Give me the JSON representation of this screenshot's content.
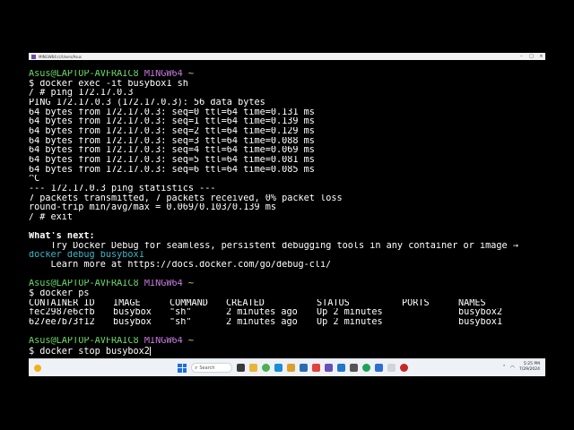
{
  "window": {
    "title": "MINGW64:/c/Users/Asus"
  },
  "terminal": {
    "prompt1": {
      "user": "Asus@LAPTOP-AVFRAIC8",
      "shell": "MINGW64",
      "path": "~"
    },
    "cmd1": "$ docker exec -it busybox1 sh",
    "cmd2": "/ # ping 172.17.0.3",
    "ping_header": "PING 172.17.0.3 (172.17.0.3): 56 data bytes",
    "ping_lines": [
      "64 bytes from 172.17.0.3: seq=0 ttl=64 time=0.131 ms",
      "64 bytes from 172.17.0.3: seq=1 ttl=64 time=0.139 ms",
      "64 bytes from 172.17.0.3: seq=2 ttl=64 time=0.129 ms",
      "64 bytes from 172.17.0.3: seq=3 ttl=64 time=0.088 ms",
      "64 bytes from 172.17.0.3: seq=4 ttl=64 time=0.069 ms",
      "64 bytes from 172.17.0.3: seq=5 ttl=64 time=0.081 ms",
      "64 bytes from 172.17.0.3: seq=6 ttl=64 time=0.085 ms"
    ],
    "interrupt": "^C",
    "stats_header": "--- 172.17.0.3 ping statistics ---",
    "stats_packets": "7 packets transmitted, 7 packets received, 0% packet loss",
    "stats_rtt": "round-trip min/avg/max = 0.069/0.103/0.139 ms",
    "exit_cmd": "/ # exit",
    "whats_next": "What's next:",
    "hint_line": "    Try Docker Debug for seamless, persistent debugging tools in any container or image →",
    "hint_cmd": "docker debug busybox1",
    "learn_more": "    Learn more at https://docs.docker.com/go/debug-cli/",
    "prompt2": {
      "user": "Asus@LAPTOP-AVFRAIC8",
      "shell": "MINGW64",
      "path": "~"
    },
    "cmd_ps": "$ docker ps",
    "ps_headers": [
      "CONTAINER ID",
      "IMAGE",
      "COMMAND",
      "CREATED",
      "STATUS",
      "PORTS",
      "NAMES"
    ],
    "ps_rows": [
      [
        "fec2987e6cfb",
        "busybox",
        "\"sh\"",
        "2 minutes ago",
        "Up 2 minutes",
        "",
        "busybox2"
      ],
      [
        "627ee7b73f12",
        "busybox",
        "\"sh\"",
        "2 minutes ago",
        "Up 2 minutes",
        "",
        "busybox1"
      ]
    ],
    "prompt3": {
      "user": "Asus@LAPTOP-AVFRAIC8",
      "shell": "MINGW64",
      "path": "~"
    },
    "current_input": "$ docker stop busybox2"
  },
  "taskbar": {
    "search_placeholder": "Search",
    "clock_time": "5:25 PM",
    "clock_date": "7/29/2024"
  },
  "colors": {
    "prompt_user": "#6ad86a",
    "prompt_shell": "#c77be0",
    "prompt_path": "#d9c96b",
    "hint_cmd": "#38b8c8"
  }
}
